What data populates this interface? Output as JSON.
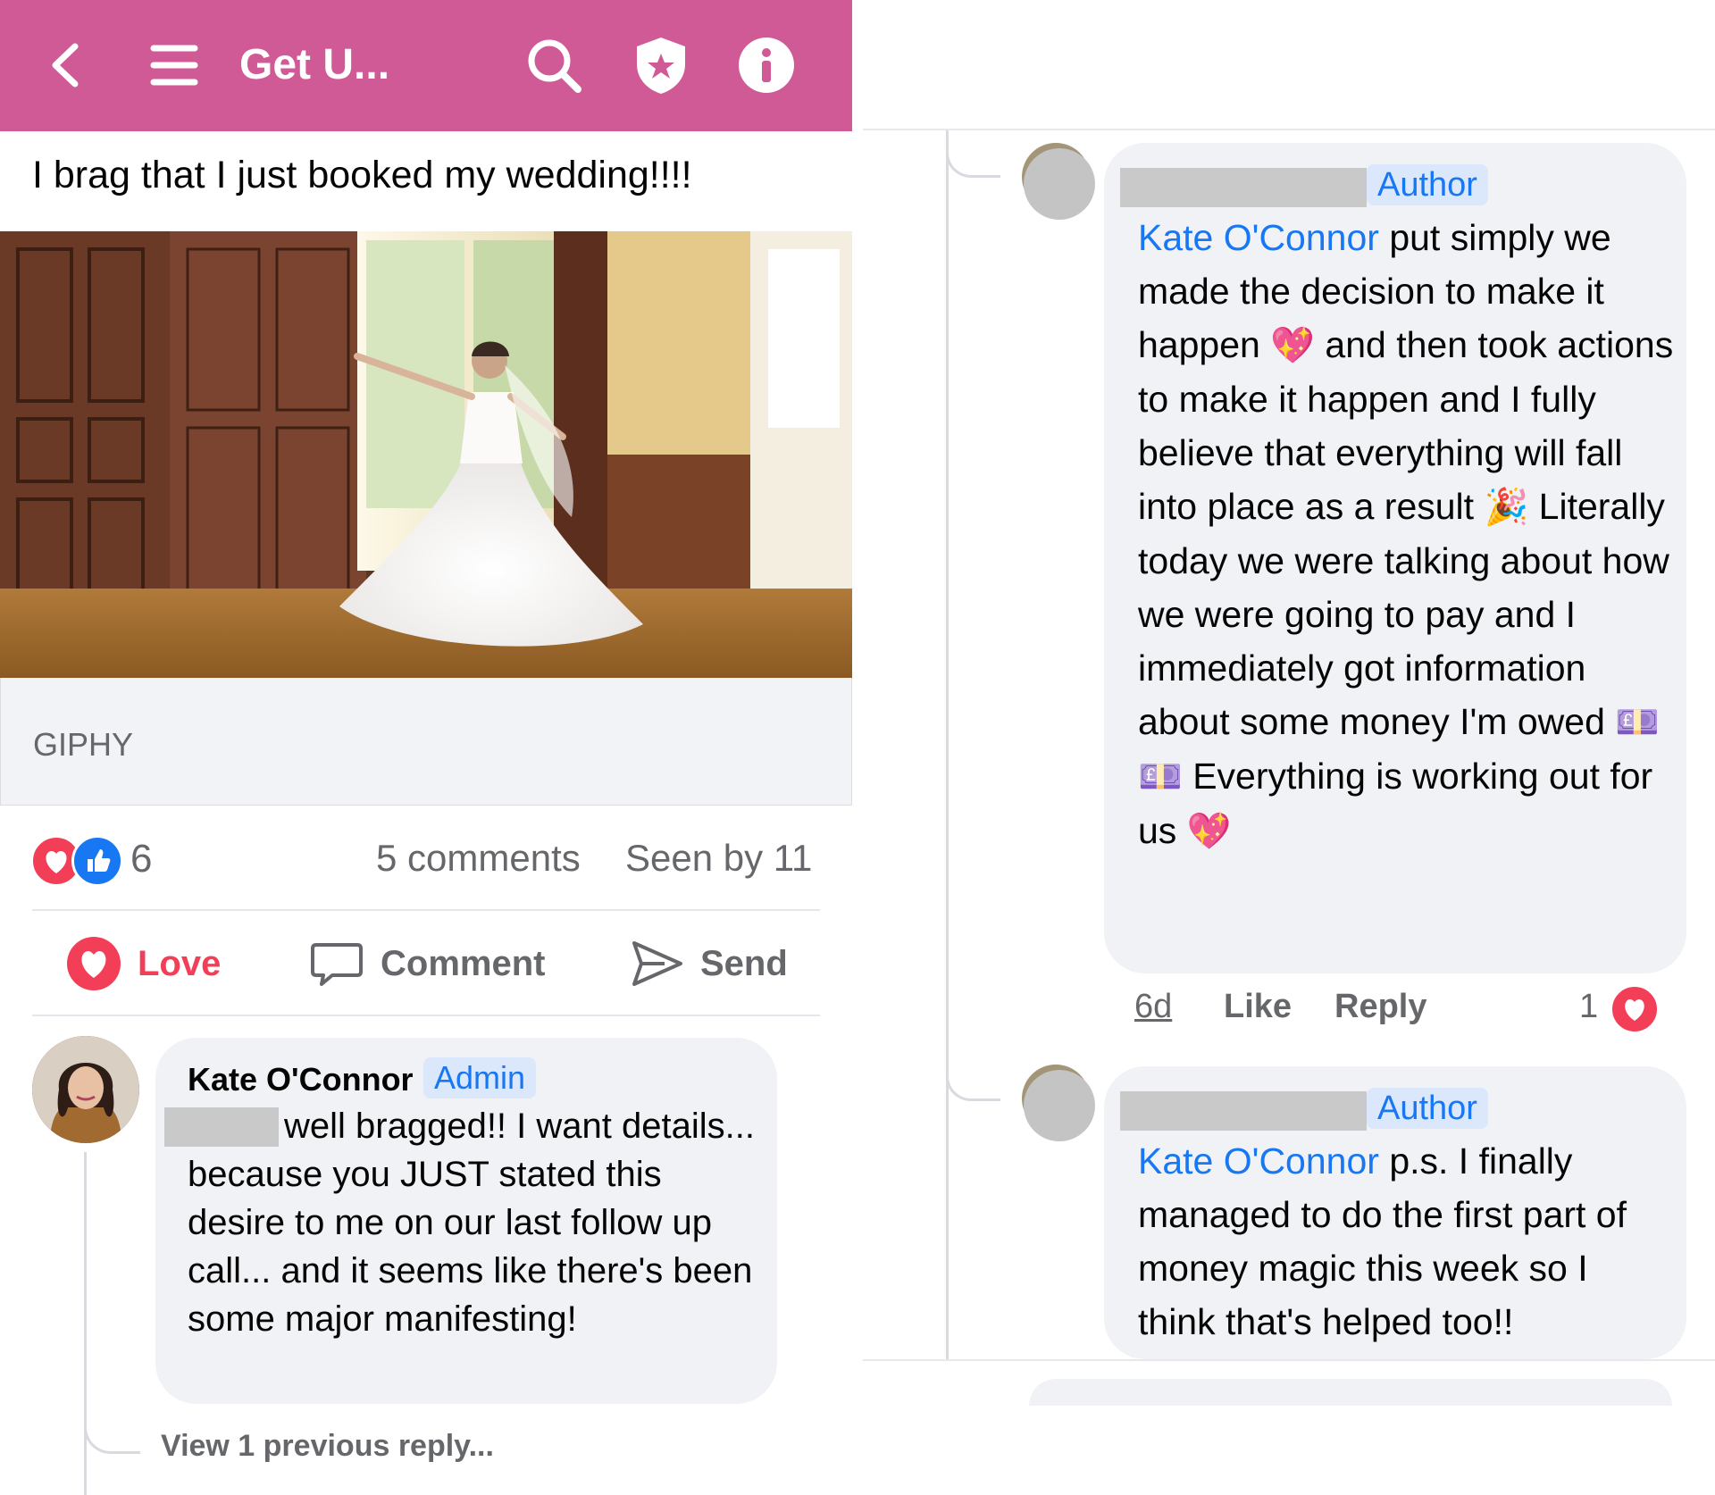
{
  "header": {
    "title": "Get U...",
    "bg_color": "#d05a96"
  },
  "post": {
    "text": "I brag that I just booked my wedding!!!!",
    "gif_source": "GIPHY",
    "reaction_count": "6",
    "comments": "5 comments",
    "seen_by": "Seen by 11"
  },
  "actions": {
    "love": "Love",
    "comment": "Comment",
    "send": "Send"
  },
  "comment_admin": {
    "author": "Kate O'Connor",
    "badge": "Admin",
    "text": "well bragged!! I want details... because you JUST stated this desire to me on our last follow up call... and it seems like there's been some major manifesting!",
    "view_replies": "View 1 previous reply..."
  },
  "reply1": {
    "badge": "Author",
    "mention": "Kate O'Connor",
    "text_parts": [
      " put simply we made the decision to make it happen ",
      " and then took actions to make it happen and I fully believe that everything will fall into place as a result ",
      " Literally today we were talking about how we were going to pay and I immediately got information about some money I'm owed ",
      " Everything is working out for us "
    ],
    "emoji": [
      "💖",
      "🎉",
      "💷 💷",
      "💖"
    ],
    "time": "6d",
    "like": "Like",
    "reply": "Reply",
    "reaction_count": "1"
  },
  "reply2": {
    "badge": "Author",
    "mention": "Kate O'Connor",
    "text": " p.s. I finally managed to do the first part of money magic this week so I think that's helped too!!"
  },
  "colors": {
    "accent_blue": "#1877f2",
    "love_red": "#f33e58",
    "bubble_bg": "#f0f2f5",
    "muted_text": "#65676b"
  }
}
